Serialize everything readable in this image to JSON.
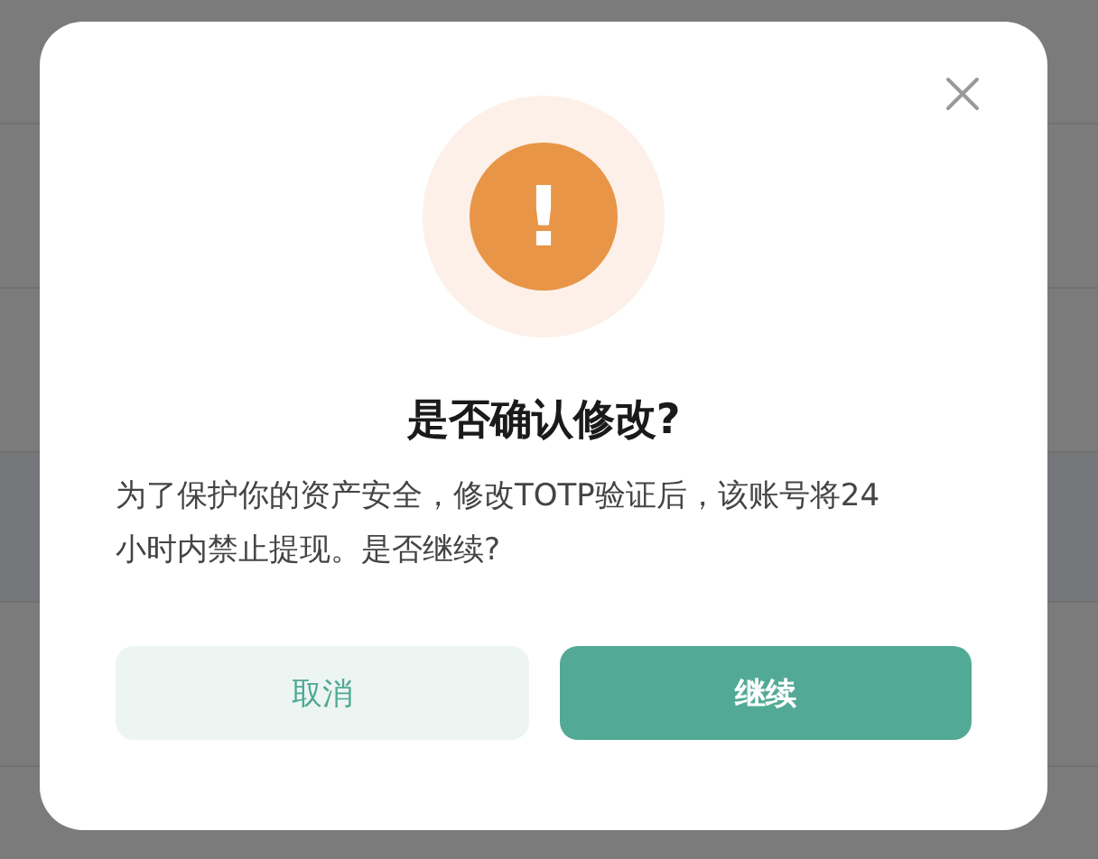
{
  "dialog": {
    "title": "是否确认修改?",
    "message": "为了保护你的资产安全，修改TOTP验证后，该账号将24小时内禁止提现。是否继续?",
    "icon": "!",
    "buttons": [
      {
        "label": "取消",
        "kind": "secondary"
      },
      {
        "label": "继续",
        "kind": "primary"
      }
    ]
  }
}
